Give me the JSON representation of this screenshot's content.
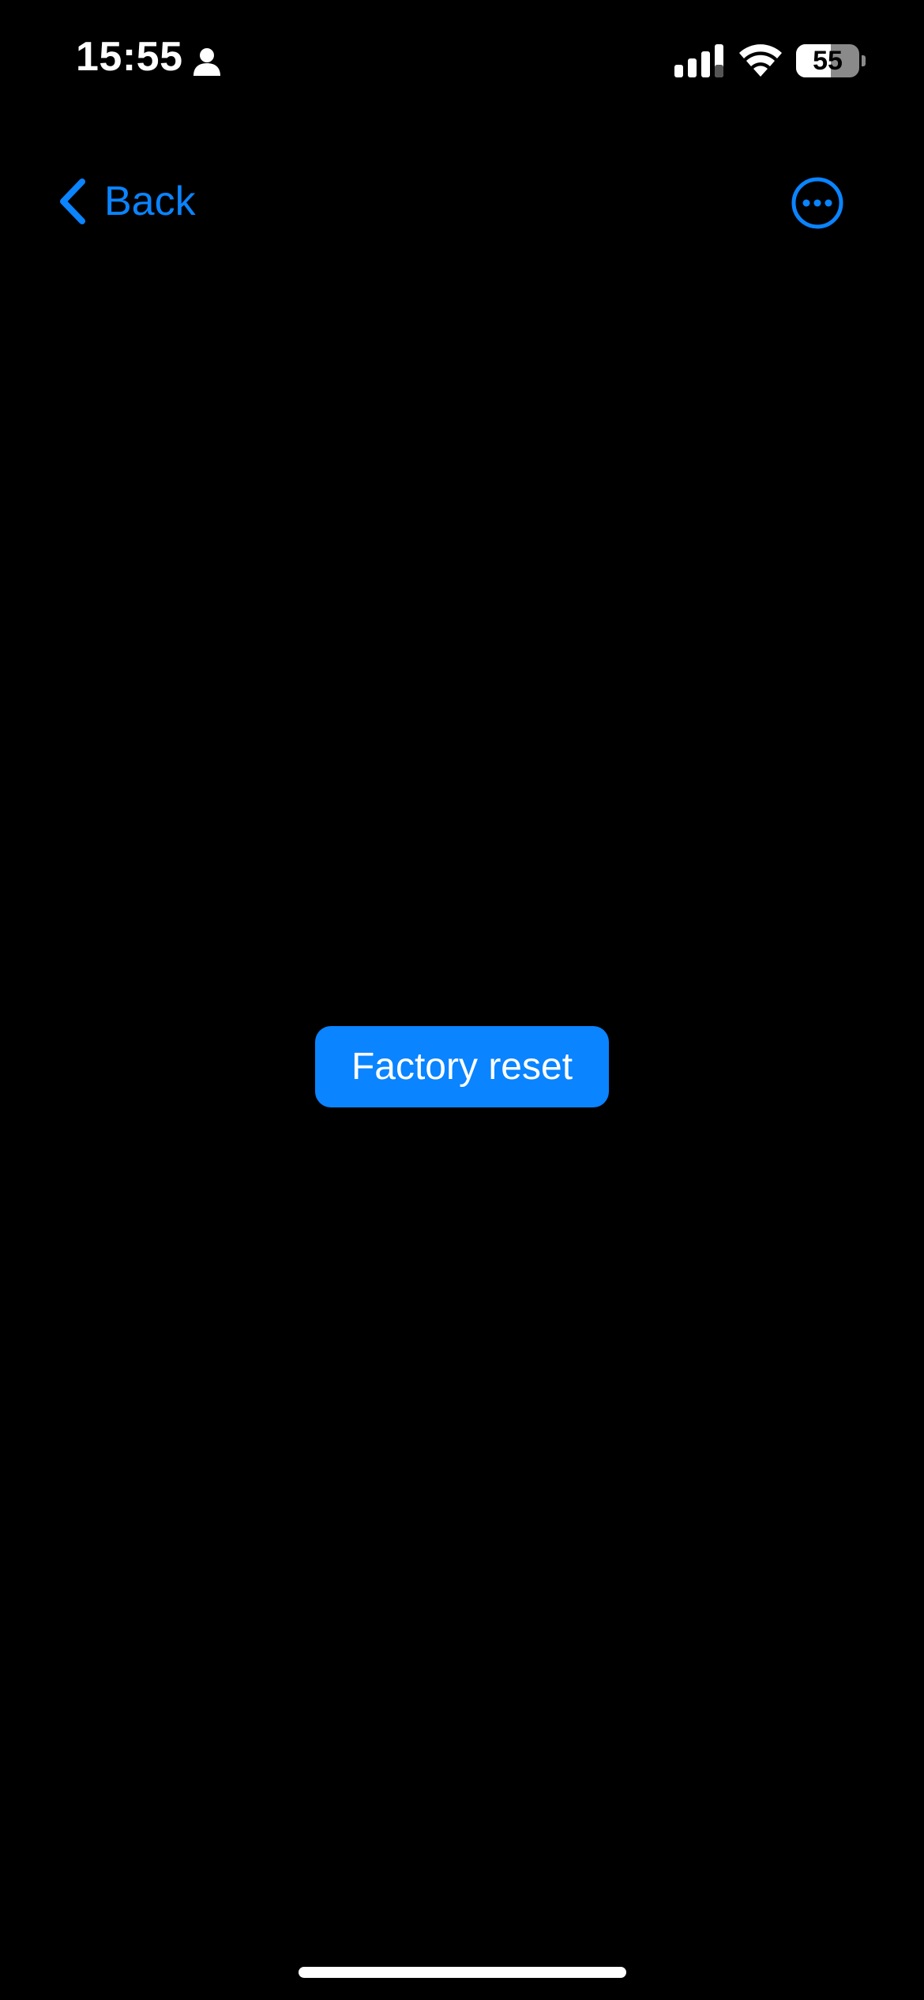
{
  "status_bar": {
    "time": "15:55",
    "battery_level": "55",
    "battery_fraction": 0.55
  },
  "nav": {
    "back_label": "Back",
    "more_icon": "ellipsis-circle-icon"
  },
  "main": {
    "action_label": "Factory reset"
  },
  "colors": {
    "accent": "#0a84ff",
    "background": "#000000",
    "text": "#ffffff"
  }
}
